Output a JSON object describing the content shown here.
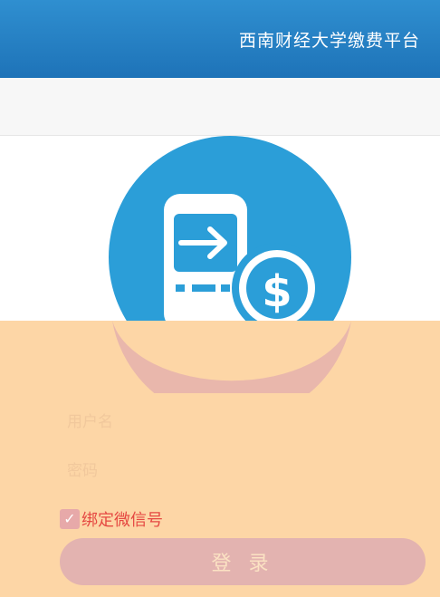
{
  "header": {
    "title": "西南财经大学缴费平台"
  },
  "form": {
    "username_placeholder": "用户名",
    "password_placeholder": "密码",
    "bind_wechat_label": "绑定微信号",
    "bind_wechat_checked": true,
    "login_label": "登 录"
  },
  "colors": {
    "header_blue": "#1e73b8",
    "logo_blue": "#2b9ed8",
    "overlay_peach": "#fdd6a6",
    "bind_label_red": "#e54842"
  }
}
